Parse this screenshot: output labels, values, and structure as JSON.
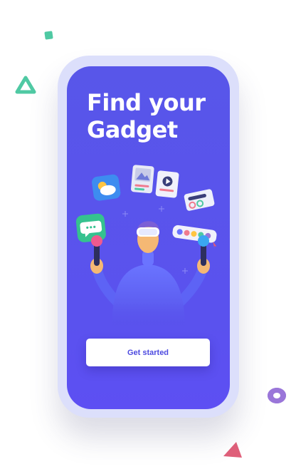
{
  "screen": {
    "title_line1": "Find your",
    "title_line2": "Gadget",
    "cta_label": "Get started"
  },
  "colors": {
    "screen_bg": "#5856e9",
    "frame_bg": "#dcdffb",
    "cta_text": "#4e4be0",
    "accent_green": "#4fc9a3",
    "accent_purple": "#9a76d9",
    "accent_pink": "#e0607a"
  },
  "illustration": {
    "subject": "person-with-vr-headset-icon",
    "floating_items": [
      "weather-app-icon",
      "image-card-icon",
      "video-card-icon",
      "chat-bubble-icon",
      "toggle-card-icon",
      "color-swatches-icon"
    ]
  }
}
